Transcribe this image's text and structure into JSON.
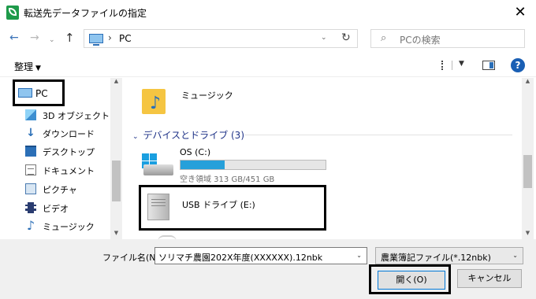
{
  "window": {
    "title": "転送先データファイルの指定",
    "close_glyph": "✕"
  },
  "nav": {
    "back_glyph": "←",
    "forward_glyph": "→",
    "recent_glyph": "⌄",
    "up_glyph": "↑",
    "address": "PC",
    "address_sep": "›",
    "address_dd": "⌄",
    "refresh_glyph": "↻",
    "search_placeholder": "PCの検索",
    "search_glyph": "⌕"
  },
  "toolbar": {
    "organize_label": "整理",
    "organize_caret": "▼",
    "view_dd": "▼",
    "help_glyph": "?"
  },
  "sidebar": {
    "items": [
      {
        "label": "PC",
        "icon": "pc-icon"
      },
      {
        "label": "3D オブジェクト",
        "icon": "3d-objects-icon"
      },
      {
        "label": "ダウンロード",
        "icon": "download-icon",
        "glyph": "↓"
      },
      {
        "label": "デスクトップ",
        "icon": "desktop-icon"
      },
      {
        "label": "ドキュメント",
        "icon": "documents-icon"
      },
      {
        "label": "ピクチャ",
        "icon": "pictures-icon"
      },
      {
        "label": "ビデオ",
        "icon": "videos-icon"
      },
      {
        "label": "ミュージック",
        "icon": "music-icon",
        "glyph": "♪"
      }
    ],
    "scroll_up": "▲",
    "scroll_down": "▼"
  },
  "content": {
    "music_folder_label": "ミュージック",
    "music_note": "♪",
    "group_chevron": "⌄",
    "group_header": "デバイスとドライブ (3)",
    "drive_c": {
      "name": "OS (C:)",
      "space": "空き領域 313 GB/451 GB",
      "used_fraction": 0.306
    },
    "drive_e": {
      "name": "USB ドライブ (E:)"
    },
    "scroll_up": "▲",
    "scroll_down": "▼"
  },
  "footer": {
    "filename_label": "ファイル名(N):",
    "filename_value": "ソリマチ農園202X年度(XXXXXX).12nbk",
    "filename_dd": "⌄",
    "filetype_value": "農業簿記ファイル(*.12nbk)",
    "filetype_dd": "⌄",
    "open_label": "開く(O)",
    "cancel_label": "キャンセル"
  },
  "colors": {
    "accent": "#0078d7",
    "group_header": "#1e3287",
    "progress": "#26a0da",
    "app_icon": "#1e9a4a"
  }
}
